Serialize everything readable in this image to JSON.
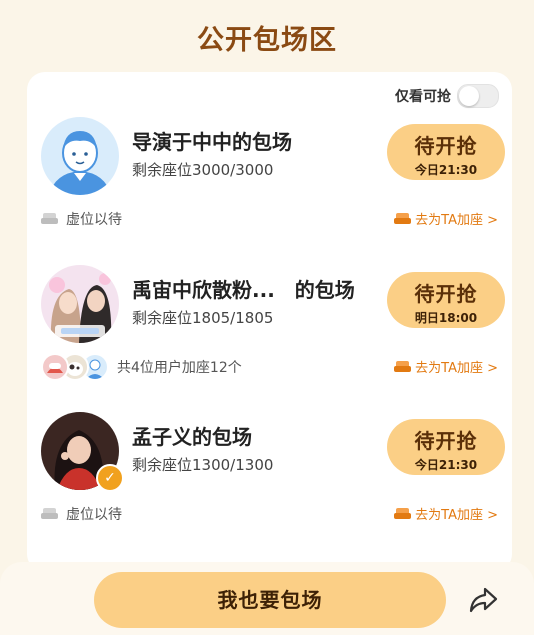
{
  "page_title": "公开包场区",
  "filter": {
    "label": "仅看可抢",
    "enabled": false
  },
  "rooms": [
    {
      "name": "导演于中中的包场",
      "seats": "剩余座位3000/3000",
      "status": "待开抢",
      "time": "今日21:30",
      "footer_text": "虚位以待",
      "join_label": "去为TA加座 >"
    },
    {
      "name": "禹宙中欣散粉...　的包场",
      "seats": "剩余座位1805/1805",
      "status": "待开抢",
      "time": "明日18:00",
      "footer_text": "共4位用户加座12个",
      "join_label": "去为TA加座 >"
    },
    {
      "name": "孟子义的包场",
      "seats": "剩余座位1300/1300",
      "status": "待开抢",
      "time": "今日21:30",
      "footer_text": "虚位以待",
      "join_label": "去为TA加座 >"
    }
  ],
  "bottom": {
    "main_button": "我也要包场",
    "share_icon": "share-icon"
  },
  "colors": {
    "accent": "#fbcf86",
    "title": "#8a4a13",
    "link": "#e27a12",
    "background": "#fbf5e8"
  }
}
